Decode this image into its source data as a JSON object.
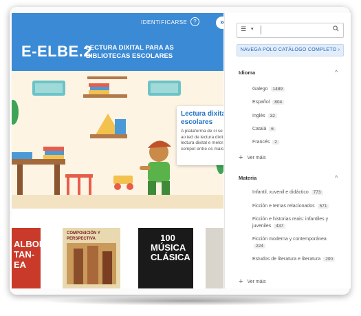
{
  "header": {
    "identify_label": "IDENTIFICARSE",
    "help_icon": "?",
    "expand_icon": "»",
    "brand": "E-ELBE.2",
    "tagline": "LECTURA DIXITAL PARA AS BIBLIOTECAS ESCOLARES"
  },
  "popup": {
    "title": "Lectura dixital e escolares",
    "text": "A plataforma de ci se expandiu ao ied de lectura dixital e da lectura dixital e melora da compet entre os máis novo"
  },
  "books": [
    {
      "text": "ALBOM TAN- EA",
      "bg": "#c93a2a",
      "fg": "#ffffff"
    },
    {
      "text": "COMPOSICIÓN Y PERSPECTIVA",
      "bg": "#e8d9b0",
      "fg": "#7a1e1e"
    },
    {
      "text": "100 MÚSICA CLÁSICA",
      "bg": "#1a1a1a",
      "fg": "#ffffff"
    },
    {
      "text": "",
      "bg": "#d9d4cc",
      "fg": "#333333"
    }
  ],
  "sidebar": {
    "search_icon": "🔍",
    "list_icon": "☰",
    "catalog_button": "NAVEGA POLO CATÁLOGO COMPLETO  ›",
    "idioma": {
      "title": "Idioma",
      "items": [
        {
          "label": "Galego",
          "count": "1489"
        },
        {
          "label": "Español",
          "count": "804"
        },
        {
          "label": "Inglés",
          "count": "32"
        },
        {
          "label": "Catalá",
          "count": "6"
        },
        {
          "label": "Francés",
          "count": "2"
        }
      ],
      "see_more": "Ver máis"
    },
    "materia": {
      "title": "Materia",
      "items": [
        {
          "label": "Infantil, xuvenil e didáctico",
          "count": "773"
        },
        {
          "label": "Ficción e temas relacionados",
          "count": "571"
        },
        {
          "label": "Ficción e historias reais: infantiles y juveniles",
          "count": "437"
        },
        {
          "label": "Ficción moderna y contemporánea",
          "count": "224"
        },
        {
          "label": "Estudos de literatura e literatura",
          "count": "200"
        }
      ],
      "see_more": "Ver máis"
    }
  },
  "colors": {
    "accent": "#3b8ad5",
    "link": "#1f66b6"
  }
}
